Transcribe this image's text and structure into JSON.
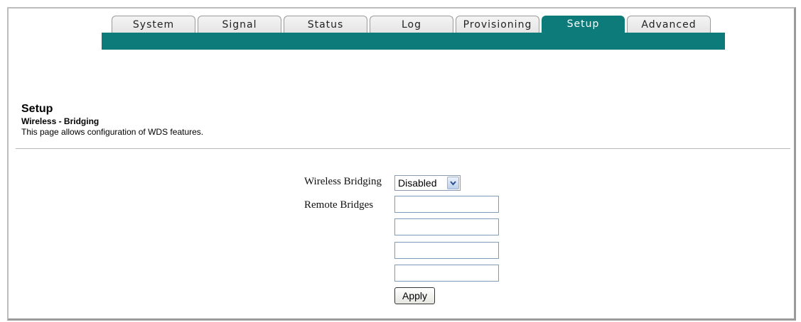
{
  "nav": {
    "tabs": [
      {
        "label": "System"
      },
      {
        "label": "Signal"
      },
      {
        "label": "Status"
      },
      {
        "label": "Log"
      },
      {
        "label": "Provisioning"
      },
      {
        "label": "Setup",
        "active": true
      },
      {
        "label": "Advanced"
      }
    ]
  },
  "header": {
    "title": "Setup",
    "subtitle": "Wireless - Bridging",
    "description": "This page allows configuration of WDS features."
  },
  "form": {
    "wireless_bridging": {
      "label": "Wireless Bridging",
      "value": "Disabled"
    },
    "remote_bridges": {
      "label": "Remote Bridges",
      "values": [
        "",
        "",
        "",
        ""
      ]
    },
    "apply_label": "Apply"
  },
  "colors": {
    "accent": "#0e7b7b"
  }
}
